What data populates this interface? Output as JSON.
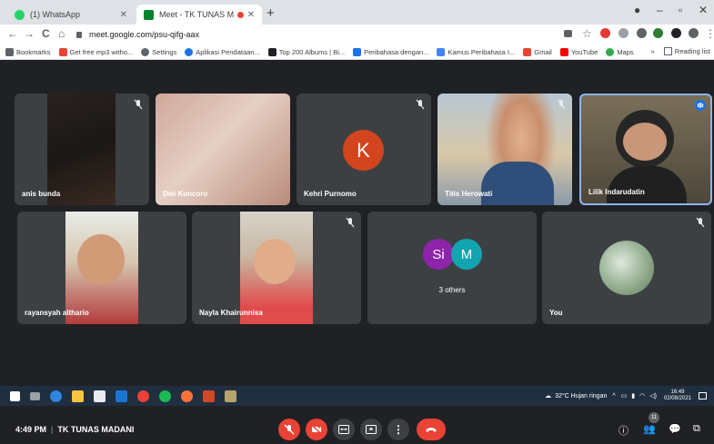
{
  "browser": {
    "tabs": [
      {
        "title": "(1) WhatsApp",
        "favicon_color": "#25d366"
      },
      {
        "title": "Meet - TK TUNAS MADANI",
        "favicon_color": "#00832d"
      }
    ],
    "new_tab": "+",
    "window_controls": {
      "min": "–",
      "max": "▫",
      "close": "✕"
    },
    "url": "meet.google.com/psu-qifg-aax",
    "bookmarks": [
      {
        "label": "Bookmarks",
        "color": "#5f6368"
      },
      {
        "label": "Get free mp3 witho...",
        "color": "#ea4335"
      },
      {
        "label": "Settings",
        "color": "#5f6368"
      },
      {
        "label": "Aplikasi Pendataan...",
        "color": "#1a73e8"
      },
      {
        "label": "Top 200 Albums | Bi...",
        "color": "#202124"
      },
      {
        "label": "Peribahasa dengan...",
        "color": "#1a73e8"
      },
      {
        "label": "Kamus Peribahasa I...",
        "color": "#4285f4"
      },
      {
        "label": "Gmail",
        "color": "#ea4335"
      },
      {
        "label": "YouTube",
        "color": "#ff0000"
      },
      {
        "label": "Maps",
        "color": "#34a853"
      }
    ],
    "reading_list": "Reading list"
  },
  "meet": {
    "participants": [
      {
        "name": "anis bunda",
        "muted": true
      },
      {
        "name": "Dwi Kuncoro",
        "muted": false
      },
      {
        "name": "Kehri Purnomo",
        "muted": true,
        "initial": "K",
        "avatar_color": "#d2451e"
      },
      {
        "name": "Titis Herowati",
        "muted": true
      },
      {
        "name": "Lilik Indarudatin",
        "muted": false,
        "speaking": true
      },
      {
        "name": "rayansyah althario",
        "muted": false
      },
      {
        "name": "Nayla Khairunnisa",
        "muted": true
      },
      {
        "name": "You",
        "muted": true
      }
    ],
    "others": {
      "label": "3 others",
      "avatars": [
        {
          "text": "Si",
          "color": "#8e24aa"
        },
        {
          "text": "M",
          "color": "#12a4af"
        }
      ]
    },
    "meeting_time": "4:49 PM",
    "meeting_name": "TK TUNAS MADANI",
    "people_count": "11"
  },
  "taskbar": {
    "weather": "32°C  Hujan ringan",
    "time": "16:49",
    "date": "02/08/2021"
  }
}
